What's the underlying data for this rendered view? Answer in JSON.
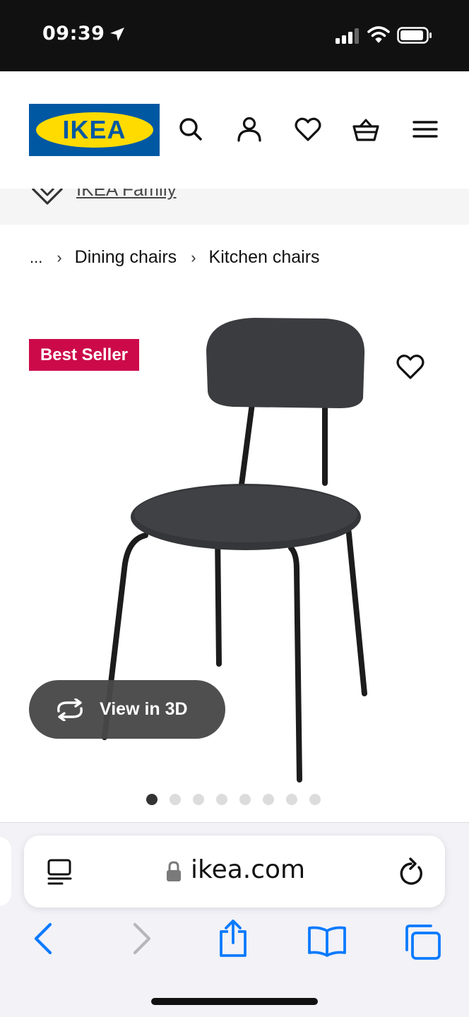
{
  "status_bar": {
    "time": "09:39",
    "battery_level": 0.85
  },
  "header": {
    "logo_text": "IKEA",
    "icons": [
      "search-icon",
      "account-icon",
      "favorites-icon",
      "basket-icon",
      "menu-icon"
    ]
  },
  "family": {
    "link_text": "IKEA Family"
  },
  "breadcrumb": {
    "ellipsis": "...",
    "separator": "›",
    "items": [
      "Dining chairs",
      "Kitchen chairs"
    ]
  },
  "product": {
    "badge": "Best Seller",
    "view_3d_label": "View in 3D",
    "image_count": 8,
    "active_image": 1
  },
  "browser": {
    "url": "ikea.com"
  },
  "colors": {
    "ikea_blue": "#0058a3",
    "ikea_yellow": "#ffdb00",
    "badge_red": "#cc0a4a",
    "ios_blue": "#0a7aff"
  }
}
